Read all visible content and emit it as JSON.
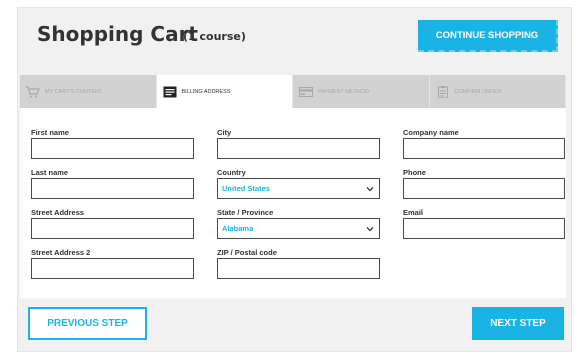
{
  "header": {
    "title": "Shopping Cart",
    "count": "(1 course)",
    "continue_label": "CONTINUE SHOPPING"
  },
  "tabs": [
    {
      "label": "MY CART'S CONTENT",
      "icon": "cart-icon",
      "active": false
    },
    {
      "label": "BILLING ADDRESS",
      "icon": "address-card-icon",
      "active": true
    },
    {
      "label": "PAYMENT METHOD",
      "icon": "credit-card-icon",
      "active": false
    },
    {
      "label": "CONFIRM ORDER",
      "icon": "clipboard-icon",
      "active": false
    }
  ],
  "form": {
    "first_name": {
      "label": "First name",
      "value": ""
    },
    "last_name": {
      "label": "Last name",
      "value": ""
    },
    "street_address": {
      "label": "Street Address",
      "value": ""
    },
    "street_address_2": {
      "label": "Street Address 2",
      "value": ""
    },
    "city": {
      "label": "City",
      "value": ""
    },
    "country": {
      "label": "Country",
      "value": "United States"
    },
    "state": {
      "label": "State / Province",
      "value": "Alabama"
    },
    "zip": {
      "label": "ZIP / Postal code",
      "value": ""
    },
    "company_name": {
      "label": "Company name",
      "value": ""
    },
    "phone": {
      "label": "Phone",
      "value": ""
    },
    "email": {
      "label": "Email",
      "value": ""
    }
  },
  "footer": {
    "previous_label": "PREVIOUS STEP",
    "next_label": "NEXT STEP"
  },
  "colors": {
    "accent": "#1ab3e6",
    "panel_bg": "#f1f1f1",
    "tab_bg": "#d2d2d2",
    "text": "#333333"
  }
}
